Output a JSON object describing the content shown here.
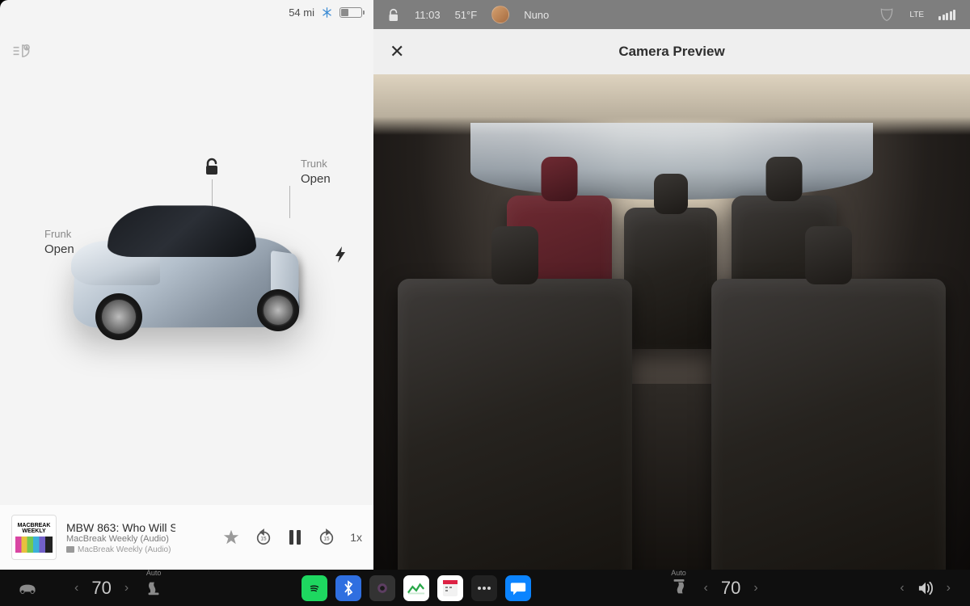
{
  "left": {
    "range": "54 mi",
    "callouts": {
      "frunk_label": "Frunk",
      "frunk_state": "Open",
      "trunk_label": "Trunk",
      "trunk_state": "Open"
    }
  },
  "media": {
    "album_line1": "MACBREAK",
    "album_line2": "WEEKLY",
    "title": "MBW 863: Who Will S",
    "subtitle": "MacBreak Weekly (Audio)",
    "source": "MacBreak Weekly (Audio)",
    "speed": "1x"
  },
  "right": {
    "status": {
      "time": "11:03",
      "temp": "51°F",
      "profile": "Nuno",
      "network": "LTE"
    },
    "preview_title": "Camera Preview"
  },
  "dock": {
    "temp_left": "70",
    "temp_right": "70",
    "auto_label_left": "Auto",
    "auto_label_right": "Auto"
  }
}
